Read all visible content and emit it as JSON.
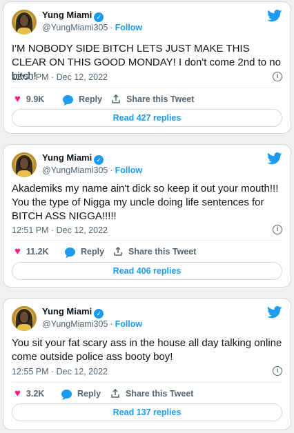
{
  "tweets": [
    {
      "name": "Yung Miami",
      "handle": "@YungMiami305",
      "follow": "Follow",
      "text": "I'M NOBODY SIDE BITCH LETS JUST MAKE THIS CLEAR ON THIS GOOD MONDAY! I don't come 2nd to no bitch!",
      "time": "12:50 PM · Dec 12, 2022",
      "likes": "9.9K",
      "reply_label": "Reply",
      "share_label": "Share this Tweet",
      "read_replies": "Read 427 replies"
    },
    {
      "name": "Yung Miami",
      "handle": "@YungMiami305",
      "follow": "Follow",
      "text": "Akademiks my name ain't dick so keep it out your mouth!!! You the type of Nigga my uncle doing life sentences for BITCH ASS NIGGA!!!!!",
      "time": "12:51 PM · Dec 12, 2022",
      "likes": "11.2K",
      "reply_label": "Reply",
      "share_label": "Share this Tweet",
      "read_replies": "Read 406 replies"
    },
    {
      "name": "Yung Miami",
      "handle": "@YungMiami305",
      "follow": "Follow",
      "text": "You sit your fat scary ass in the house all day talking online come outside police ass booty boy!",
      "time": "12:55 PM · Dec 12, 2022",
      "likes": "3.2K",
      "reply_label": "Reply",
      "share_label": "Share this Tweet",
      "read_replies": "Read 137 replies"
    }
  ],
  "icons": {
    "verified": "verified-badge-icon",
    "twitter": "twitter-bird-icon",
    "info": "info-icon",
    "like": "heart-icon",
    "reply": "reply-bubble-icon",
    "share": "share-upload-icon"
  },
  "colors": {
    "accent": "#1d9bf0",
    "like": "#f91880",
    "muted": "#536471",
    "text": "#0f1419"
  }
}
